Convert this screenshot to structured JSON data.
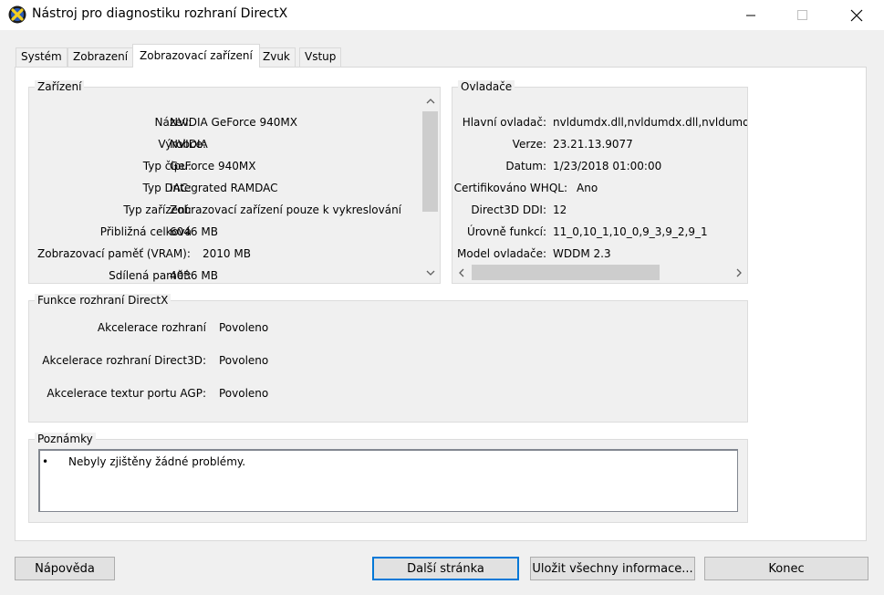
{
  "window": {
    "title": "Nástroj pro diagnostiku rozhraní DirectX",
    "icon": "directx-icon",
    "controls": [
      "minimize-icon",
      "maximize-icon",
      "close-icon"
    ]
  },
  "tabs": [
    {
      "label": "Systém",
      "active": false
    },
    {
      "label": "Zobrazení",
      "active": false
    },
    {
      "label": "Zobrazovací zařízení",
      "active": true
    },
    {
      "label": "Zvuk",
      "active": false
    },
    {
      "label": "Vstup",
      "active": false
    }
  ],
  "device": {
    "title": "Zařízení",
    "rows": [
      {
        "label": "Název:",
        "value": "NVIDIA GeForce 940MX"
      },
      {
        "label": "Výrobce:",
        "value": "NVIDIA"
      },
      {
        "label": "Typ čipu:",
        "value": "GeForce 940MX"
      },
      {
        "label": "Typ DAC:",
        "value": "Integrated RAMDAC"
      },
      {
        "label": "Typ zařízení:",
        "value": "Zobrazovací zařízení pouze k vykreslování"
      },
      {
        "label": "Přibližná celková",
        "value": "6046 MB"
      },
      {
        "label": "Zobrazovací paměť (VRAM):",
        "value": "2010 MB"
      },
      {
        "label": "Sdílená paměť:",
        "value": "4036 MB"
      }
    ]
  },
  "drivers": {
    "title": "Ovladače",
    "rows": [
      {
        "label": "Hlavní ovladač:",
        "value": "nvldumdx.dll,nvldumdx.dll,nvldumdx.d"
      },
      {
        "label": "Verze:",
        "value": "23.21.13.9077"
      },
      {
        "label": "Datum:",
        "value": "1/23/2018 01:00:00"
      },
      {
        "label": "Certifikováno WHQL:",
        "value": "Ano"
      },
      {
        "label": "Direct3D DDI:",
        "value": "12"
      },
      {
        "label": "Úrovně funkcí:",
        "value": "11_0,10_1,10_0,9_3,9_2,9_1"
      },
      {
        "label": "Model ovladače:",
        "value": "WDDM 2.3"
      }
    ]
  },
  "directx_features": {
    "title": "Funkce rozhraní DirectX",
    "rows": [
      {
        "label": "Akcelerace rozhraní",
        "value": "Povoleno"
      },
      {
        "label": "Akcelerace rozhraní Direct3D:",
        "value": "Povoleno"
      },
      {
        "label": "Akcelerace textur portu AGP:",
        "value": "Povoleno"
      }
    ]
  },
  "notes": {
    "title": "Poznámky",
    "items": [
      "Nebyly zjištěny žádné problémy."
    ]
  },
  "buttons": {
    "help": "Nápověda",
    "next_page": "Další stránka",
    "save_all": "Uložit všechny informace...",
    "exit": "Konec"
  }
}
